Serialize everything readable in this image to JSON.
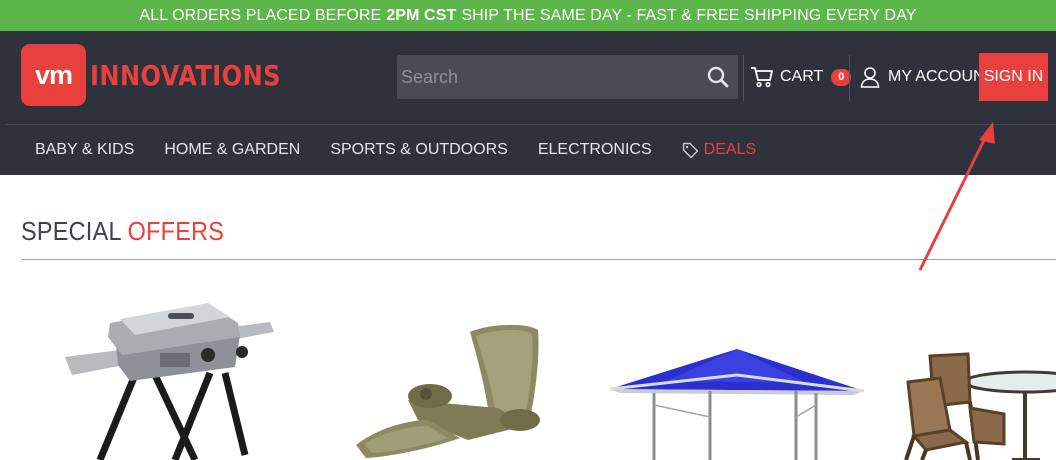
{
  "promo": {
    "before": "ALL ORDERS PLACED BEFORE",
    "bold": "2PM CST",
    "after": "SHIP THE SAME DAY - FAST & FREE SHIPPING EVERY DAY"
  },
  "logo": {
    "mark": "vm",
    "text": "INNOVATIONS"
  },
  "search": {
    "placeholder": "Search",
    "value": ""
  },
  "cart": {
    "label": "CART",
    "count": "0"
  },
  "account": {
    "label": "MY ACCOUNT"
  },
  "signin": {
    "label": "SIGN IN"
  },
  "nav": {
    "items": [
      {
        "label": "BABY & KIDS"
      },
      {
        "label": "HOME & GARDEN"
      },
      {
        "label": "SPORTS & OUTDOORS"
      },
      {
        "label": "ELECTRONICS"
      },
      {
        "label": "DEALS"
      }
    ]
  },
  "section": {
    "title_part1": "SPECIAL",
    "title_part2": "OFFERS"
  },
  "colors": {
    "promo_bg": "#5cb64a",
    "header_bg": "#2d323d",
    "accent": "#e8413d",
    "annotation_arrow": "#e8413d"
  },
  "icons": {
    "search": "magnifier-icon",
    "cart": "shopping-cart-icon",
    "account": "user-icon",
    "deals": "price-tag-icon"
  },
  "products": [
    {
      "name": "portable-grill-product"
    },
    {
      "name": "pool-lounger-product"
    },
    {
      "name": "canopy-tent-product"
    },
    {
      "name": "patio-dining-set-product"
    }
  ]
}
